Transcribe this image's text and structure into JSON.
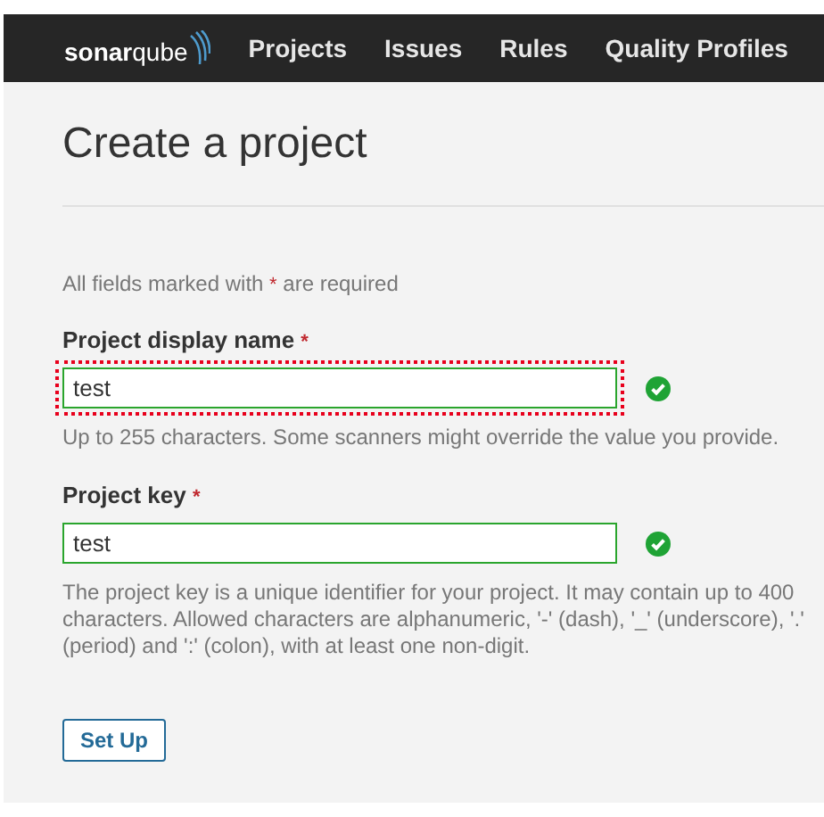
{
  "navbar": {
    "logo": "**sonar**qube",
    "items": [
      "Projects",
      "Issues",
      "Rules",
      "Quality Profiles"
    ]
  },
  "page": {
    "title": "Create a project",
    "required_note_before": "All fields marked with",
    "required_mark": "*",
    "required_note_after": "are required"
  },
  "fields": [
    {
      "label": "Project display name",
      "required_mark": "*",
      "value": "test",
      "valid": true,
      "highlighted": true,
      "help": "Up to 255 characters. Some scanners might override the value you provide."
    },
    {
      "label": "Project key",
      "required_mark": "*",
      "value": "test",
      "valid": true,
      "highlighted": false,
      "help": "The project key is a unique identifier for your project. It may contain up to 400 characters. Allowed characters are alphanumeric, '-' (dash), '_' (underscore), '.' (period) and ':' (colon), with at least one non-digit."
    }
  ],
  "buttons": [
    "Set Up"
  ]
}
